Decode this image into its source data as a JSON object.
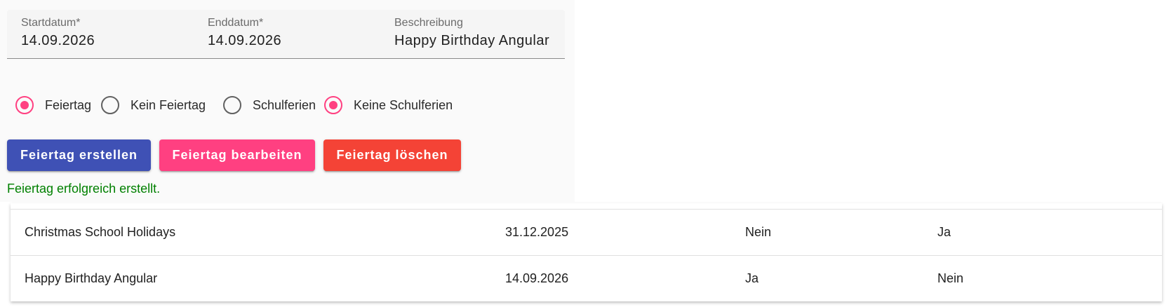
{
  "form": {
    "start_date": {
      "label": "Startdatum*",
      "value": "14.09.2026"
    },
    "end_date": {
      "label": "Enddatum*",
      "value": "14.09.2026"
    },
    "description": {
      "label": "Beschreibung",
      "value": "Happy Birthday Angular"
    }
  },
  "radios": {
    "holiday_group": [
      {
        "label": "Feiertag",
        "checked": true
      },
      {
        "label": "Kein Feiertag",
        "checked": false
      }
    ],
    "school_group": [
      {
        "label": "Schulferien",
        "checked": false
      },
      {
        "label": "Keine Schulferien",
        "checked": true
      }
    ]
  },
  "buttons": {
    "create": "Feiertag erstellen",
    "edit": "Feiertag bearbeiten",
    "delete": "Feiertag löschen"
  },
  "colors": {
    "primary": "#3f51b5",
    "accent": "#ff4081",
    "warn": "#f44336",
    "success_text": "#008000"
  },
  "status_message": "Feiertag erfolgreich erstellt.",
  "table": {
    "rows": [
      [
        "Christmas School Holidays",
        "31.12.2025",
        "Nein",
        "Ja"
      ],
      [
        "Happy Birthday Angular",
        "14.09.2026",
        "Ja",
        "Nein"
      ]
    ]
  }
}
